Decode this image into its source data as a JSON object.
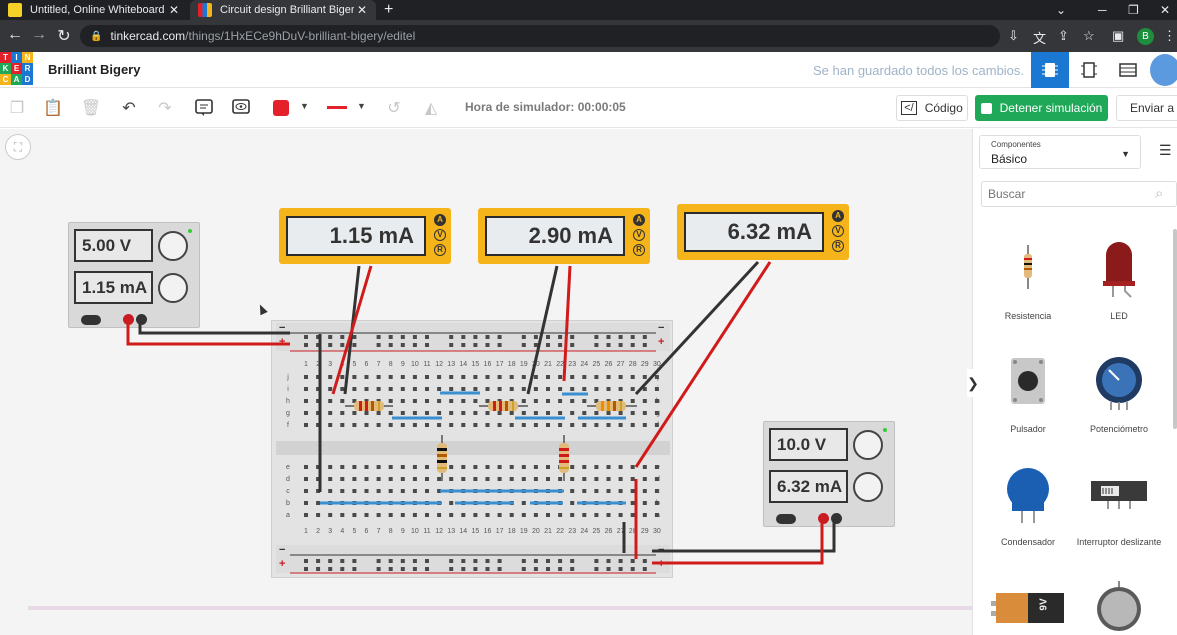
{
  "browser": {
    "tabs": [
      {
        "title": "Untitled, Online Whiteboard for Visual",
        "close": "✕"
      },
      {
        "title": "Circuit design Brilliant Bigery | Tinkercad",
        "close": "✕"
      }
    ],
    "new_tab": "+",
    "url_host": "tinkercad.com",
    "url_path": "/things/1HxECe9hDuV-brilliant-bigery/editel",
    "profile_initial": "B"
  },
  "app": {
    "logo_letters": [
      "T",
      "I",
      "N",
      "K",
      "E",
      "R",
      "C",
      "A",
      "D"
    ],
    "logo_colors": [
      "#e4202a",
      "#1a77d2",
      "#f4b41a",
      "#1fa857",
      "#e4202a",
      "#1a77d2",
      "#f4b41a",
      "#1fa857",
      "#1a77d2"
    ],
    "project_name": "Brilliant Bigery",
    "save_status": "Se han guardado todos los cambios."
  },
  "toolbar": {
    "sim_time_label": "Hora de simulador: 00:00:05",
    "code_label": "Código",
    "stop_sim_label": "Detener simulación",
    "send_label": "Enviar a",
    "wire_color": "#e4202a"
  },
  "circuit": {
    "psu_left": {
      "voltage": "5.00 V",
      "current": "1.15 mA"
    },
    "psu_right": {
      "voltage": "10.0 V",
      "current": "6.32 mA"
    },
    "meters": [
      {
        "reading": "1.15 mA",
        "active_mode": "A"
      },
      {
        "reading": "2.90 mA",
        "active_mode": "A"
      },
      {
        "reading": "6.32 mA",
        "active_mode": "A"
      }
    ],
    "meter_modes": [
      "A",
      "V",
      "R"
    ],
    "column_numbers": [
      "1",
      "2",
      "3",
      "4",
      "5",
      "6",
      "7",
      "8",
      "9",
      "10",
      "11",
      "12",
      "13",
      "14",
      "15",
      "16",
      "17",
      "18",
      "19",
      "20",
      "21",
      "22",
      "23",
      "24",
      "25",
      "26",
      "27",
      "28",
      "29",
      "30"
    ],
    "rows_top": [
      "j",
      "i",
      "h",
      "g",
      "f"
    ],
    "rows_bottom": [
      "e",
      "d",
      "c",
      "b",
      "a"
    ],
    "rail_minus": "−",
    "rail_plus": "+"
  },
  "panel": {
    "components_label": "Componentes",
    "components_value": "Básico",
    "search_placeholder": "Buscar",
    "items": [
      {
        "name": "Resistencia",
        "icon": "resistor-icon"
      },
      {
        "name": "LED",
        "icon": "led-icon"
      },
      {
        "name": "Pulsador",
        "icon": "pushbutton-icon"
      },
      {
        "name": "Potenciómetro",
        "icon": "potentiometer-icon"
      },
      {
        "name": "Condensador",
        "icon": "capacitor-icon"
      },
      {
        "name": "Interruptor deslizante",
        "icon": "slide-switch-icon"
      },
      {
        "name": "",
        "icon": "battery-9v-icon"
      },
      {
        "name": "",
        "icon": "coin-battery-icon"
      }
    ],
    "battery_label": "9V"
  }
}
